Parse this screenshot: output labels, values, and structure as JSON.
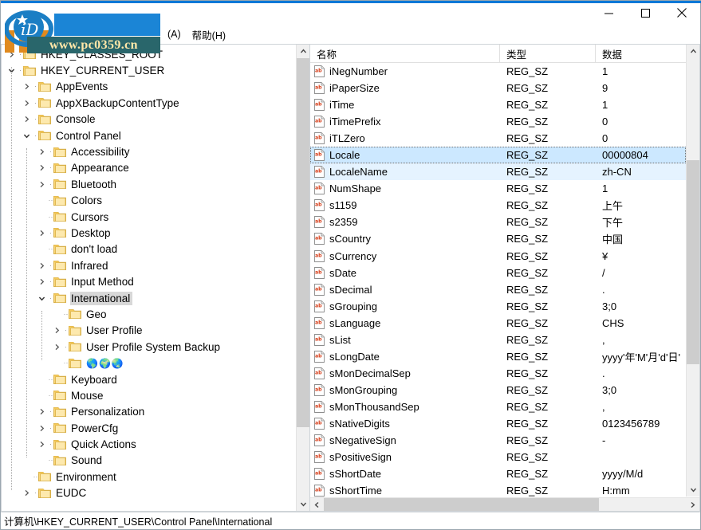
{
  "window": {
    "accent_color": "#0078d7",
    "controls": [
      {
        "name": "minimize",
        "glyph": "—"
      },
      {
        "name": "maximize",
        "glyph": "□"
      },
      {
        "name": "close",
        "glyph": "✕"
      }
    ]
  },
  "overlay": {
    "watermark_text": "www.pc0359.cn",
    "watermark_bg": "#29666b",
    "watermark_color": "#ffe7a8",
    "block_color": "#1b85d6"
  },
  "menubar": {
    "items": [
      {
        "label": "(A)"
      },
      {
        "label": "帮助(H)"
      }
    ]
  },
  "tree": {
    "nodes": [
      {
        "label": "HKEY_CLASSES_ROOT",
        "depth": 0,
        "state": "collapsed",
        "selected": false
      },
      {
        "label": "HKEY_CURRENT_USER",
        "depth": 0,
        "state": "expanded",
        "selected": false
      },
      {
        "label": "AppEvents",
        "depth": 1,
        "state": "collapsed",
        "selected": false
      },
      {
        "label": "AppXBackupContentType",
        "depth": 1,
        "state": "collapsed",
        "selected": false
      },
      {
        "label": "Console",
        "depth": 1,
        "state": "collapsed",
        "selected": false
      },
      {
        "label": "Control Panel",
        "depth": 1,
        "state": "expanded",
        "selected": false
      },
      {
        "label": "Accessibility",
        "depth": 2,
        "state": "collapsed",
        "selected": false
      },
      {
        "label": "Appearance",
        "depth": 2,
        "state": "collapsed",
        "selected": false
      },
      {
        "label": "Bluetooth",
        "depth": 2,
        "state": "collapsed",
        "selected": false
      },
      {
        "label": "Colors",
        "depth": 2,
        "state": "leaf",
        "selected": false
      },
      {
        "label": "Cursors",
        "depth": 2,
        "state": "leaf",
        "selected": false
      },
      {
        "label": "Desktop",
        "depth": 2,
        "state": "collapsed",
        "selected": false
      },
      {
        "label": "don't load",
        "depth": 2,
        "state": "leaf",
        "selected": false
      },
      {
        "label": "Infrared",
        "depth": 2,
        "state": "collapsed",
        "selected": false
      },
      {
        "label": "Input Method",
        "depth": 2,
        "state": "collapsed",
        "selected": false
      },
      {
        "label": "International",
        "depth": 2,
        "state": "expanded",
        "selected": true
      },
      {
        "label": "Geo",
        "depth": 3,
        "state": "leaf",
        "selected": false
      },
      {
        "label": "User Profile",
        "depth": 3,
        "state": "collapsed",
        "selected": false
      },
      {
        "label": "User Profile System Backup",
        "depth": 3,
        "state": "collapsed",
        "selected": false
      },
      {
        "label": "🌎🌍🌏",
        "depth": 3,
        "state": "leaf",
        "selected": false,
        "emoji": true
      },
      {
        "label": "Keyboard",
        "depth": 2,
        "state": "leaf",
        "selected": false
      },
      {
        "label": "Mouse",
        "depth": 2,
        "state": "leaf",
        "selected": false
      },
      {
        "label": "Personalization",
        "depth": 2,
        "state": "collapsed",
        "selected": false
      },
      {
        "label": "PowerCfg",
        "depth": 2,
        "state": "collapsed",
        "selected": false
      },
      {
        "label": "Quick Actions",
        "depth": 2,
        "state": "collapsed",
        "selected": false
      },
      {
        "label": "Sound",
        "depth": 2,
        "state": "leaf",
        "selected": false
      },
      {
        "label": "Environment",
        "depth": 1,
        "state": "leaf",
        "selected": false
      },
      {
        "label": "EUDC",
        "depth": 1,
        "state": "collapsed",
        "selected": false
      }
    ]
  },
  "list": {
    "columns": [
      {
        "key": "name",
        "label": "名称"
      },
      {
        "key": "type",
        "label": "类型"
      },
      {
        "key": "data",
        "label": "数据"
      }
    ],
    "rows": [
      {
        "name": "iNegNumber",
        "type": "REG_SZ",
        "data": "1",
        "state": "none"
      },
      {
        "name": "iPaperSize",
        "type": "REG_SZ",
        "data": "9",
        "state": "none"
      },
      {
        "name": "iTime",
        "type": "REG_SZ",
        "data": "1",
        "state": "none"
      },
      {
        "name": "iTimePrefix",
        "type": "REG_SZ",
        "data": "0",
        "state": "none"
      },
      {
        "name": "iTLZero",
        "type": "REG_SZ",
        "data": "0",
        "state": "none"
      },
      {
        "name": "Locale",
        "type": "REG_SZ",
        "data": "00000804",
        "state": "focus"
      },
      {
        "name": "LocaleName",
        "type": "REG_SZ",
        "data": "zh-CN",
        "state": "selected"
      },
      {
        "name": "NumShape",
        "type": "REG_SZ",
        "data": "1",
        "state": "none"
      },
      {
        "name": "s1159",
        "type": "REG_SZ",
        "data": "上午",
        "state": "none"
      },
      {
        "name": "s2359",
        "type": "REG_SZ",
        "data": "下午",
        "state": "none"
      },
      {
        "name": "sCountry",
        "type": "REG_SZ",
        "data": "中国",
        "state": "none"
      },
      {
        "name": "sCurrency",
        "type": "REG_SZ",
        "data": "¥",
        "state": "none"
      },
      {
        "name": "sDate",
        "type": "REG_SZ",
        "data": "/",
        "state": "none"
      },
      {
        "name": "sDecimal",
        "type": "REG_SZ",
        "data": ".",
        "state": "none"
      },
      {
        "name": "sGrouping",
        "type": "REG_SZ",
        "data": "3;0",
        "state": "none"
      },
      {
        "name": "sLanguage",
        "type": "REG_SZ",
        "data": "CHS",
        "state": "none"
      },
      {
        "name": "sList",
        "type": "REG_SZ",
        "data": ",",
        "state": "none"
      },
      {
        "name": "sLongDate",
        "type": "REG_SZ",
        "data": "yyyy'年'M'月'd'日'",
        "state": "none"
      },
      {
        "name": "sMonDecimalSep",
        "type": "REG_SZ",
        "data": ".",
        "state": "none"
      },
      {
        "name": "sMonGrouping",
        "type": "REG_SZ",
        "data": "3;0",
        "state": "none"
      },
      {
        "name": "sMonThousandSep",
        "type": "REG_SZ",
        "data": ",",
        "state": "none"
      },
      {
        "name": "sNativeDigits",
        "type": "REG_SZ",
        "data": "0123456789",
        "state": "none"
      },
      {
        "name": "sNegativeSign",
        "type": "REG_SZ",
        "data": "-",
        "state": "none"
      },
      {
        "name": "sPositiveSign",
        "type": "REG_SZ",
        "data": "",
        "state": "none"
      },
      {
        "name": "sShortDate",
        "type": "REG_SZ",
        "data": "yyyy/M/d",
        "state": "none"
      },
      {
        "name": "sShortTime",
        "type": "REG_SZ",
        "data": "H:mm",
        "state": "none"
      }
    ]
  },
  "statusbar": {
    "path": "计算机\\HKEY_CURRENT_USER\\Control Panel\\International"
  }
}
